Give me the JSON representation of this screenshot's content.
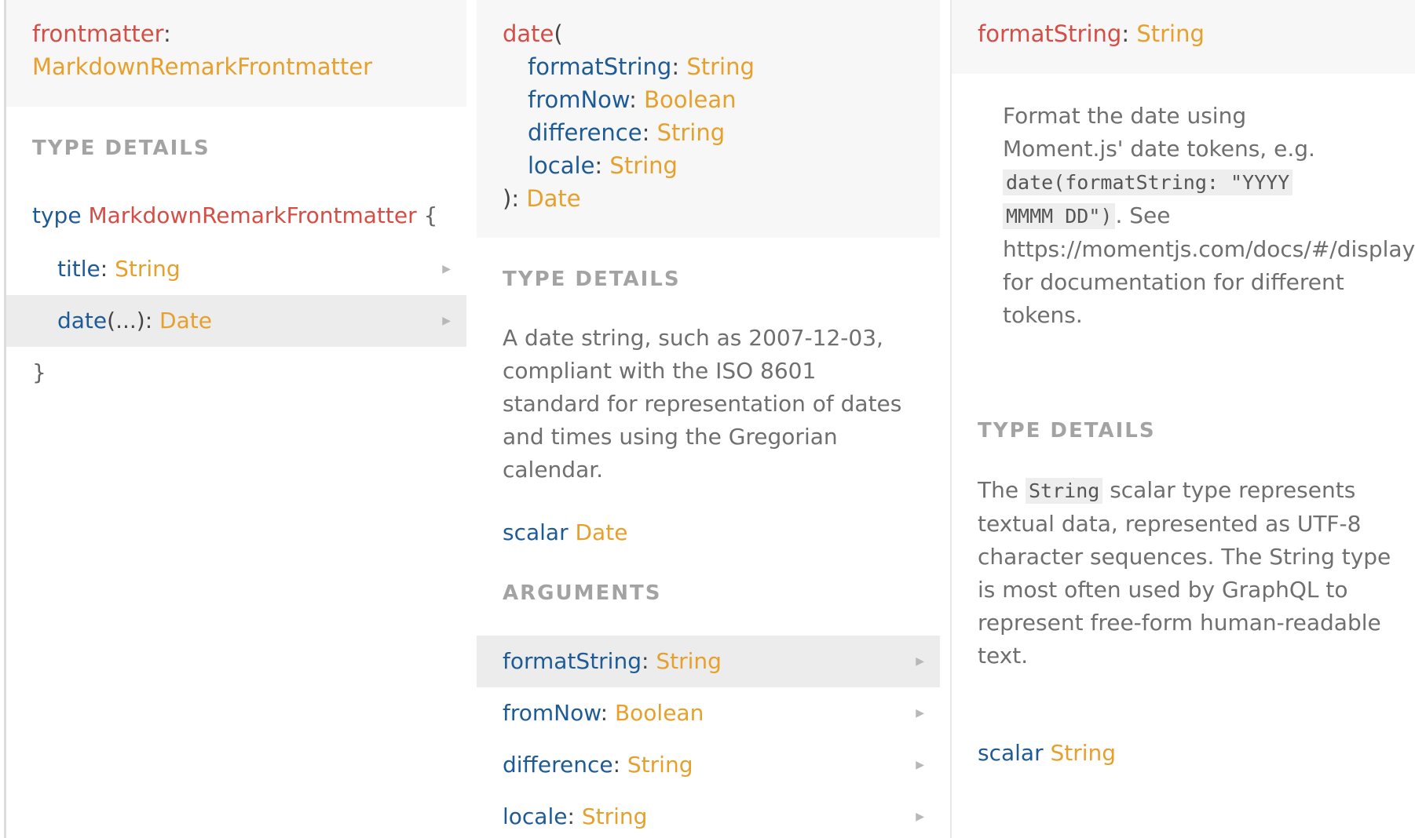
{
  "col1": {
    "header": {
      "field": "frontmatter",
      "colon": ":",
      "type": "MarkdownRemarkFrontmatter"
    },
    "section_title": "TYPE DETAILS",
    "decl": {
      "keyword": "type",
      "name": "MarkdownRemarkFrontmatter",
      "open": "{",
      "close": "}"
    },
    "fields": [
      {
        "name": "title",
        "sep": ": ",
        "type": "String",
        "arrow": "▶"
      },
      {
        "name": "date",
        "args": "(...)",
        "sep": ": ",
        "type": "Date",
        "arrow": "▶"
      }
    ]
  },
  "col2": {
    "header": {
      "name": "date",
      "open": "(",
      "args": [
        {
          "name": "formatString",
          "sep": ": ",
          "type": "String"
        },
        {
          "name": "fromNow",
          "sep": ": ",
          "type": "Boolean"
        },
        {
          "name": "difference",
          "sep": ": ",
          "type": "String"
        },
        {
          "name": "locale",
          "sep": ": ",
          "type": "String"
        }
      ],
      "close": "): ",
      "return_type": "Date"
    },
    "section_title": "TYPE DETAILS",
    "description": "A date string, such as 2007-12-03, compliant with the ISO 8601 standard for representation of dates and times using the Gregorian calendar.",
    "scalar": {
      "keyword": "scalar",
      "name": "Date"
    },
    "arguments_title": "ARGUMENTS",
    "arguments": [
      {
        "name": "formatString",
        "sep": ": ",
        "type": "String",
        "arrow": "▶"
      },
      {
        "name": "fromNow",
        "sep": ": ",
        "type": "Boolean",
        "arrow": "▶"
      },
      {
        "name": "difference",
        "sep": ": ",
        "type": "String",
        "arrow": "▶"
      },
      {
        "name": "locale",
        "sep": ": ",
        "type": "String",
        "arrow": "▶"
      }
    ]
  },
  "col3": {
    "header": {
      "field": "formatString",
      "colon": ": ",
      "type": "String"
    },
    "description": {
      "l1": "Format the date using",
      "l2": "Moment.js' date tokens, e.g.",
      "code1": "date(formatString: \"YYYY",
      "code2": "MMMM DD\")",
      "after_code": ". See",
      "l4": "https://momentjs.com/docs/#/displayi",
      "l5": "for documentation for different",
      "l6": "tokens."
    },
    "section_title": "TYPE DETAILS",
    "type_desc": {
      "pre": "The ",
      "code": "String",
      "post1": " scalar type represents",
      "l2": "textual data, represented as UTF-8",
      "l3": "character sequences. The String type",
      "l4": "is most often used by GraphQL to",
      "l5": "represent free-form human-readable",
      "l6": "text."
    },
    "scalar": {
      "keyword": "scalar",
      "name": "String"
    }
  }
}
